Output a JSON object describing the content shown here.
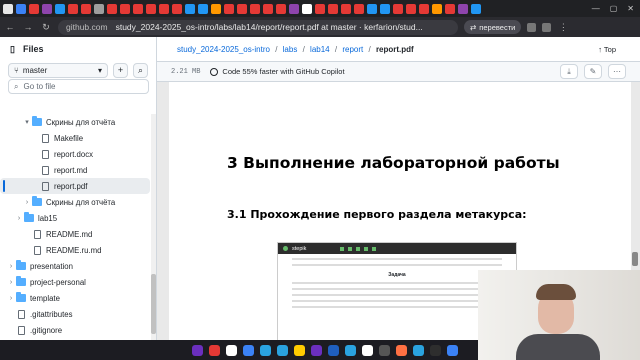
{
  "browser": {
    "url_host": "github.com",
    "url_title": "study_2024-2025_os-intro/labs/lab14/report/report.pdf at master · kerfarion/stud...",
    "translate_label": "перевести",
    "tab_colors": [
      "#e7e7e7",
      "#3b82f6",
      "#e53935",
      "#8e44ad",
      "#2196f3",
      "#e53935",
      "#e53935",
      "#9e9e9e",
      "#e53935",
      "#e53935",
      "#e53935",
      "#e53935",
      "#e53935",
      "#e53935",
      "#2196f3",
      "#2196f3",
      "#ff9800",
      "#e53935",
      "#e53935",
      "#e53935",
      "#e53935",
      "#e53935",
      "#8e44ad",
      "#ffffff",
      "#e53935",
      "#e53935",
      "#e53935",
      "#e53935",
      "#2196f3",
      "#2196f3",
      "#e53935",
      "#e53935",
      "#e53935",
      "#ff9800",
      "#e53935",
      "#8e44ad",
      "#2196f3"
    ]
  },
  "sidebar": {
    "title": "Files",
    "branch": "master",
    "search_placeholder": "Go to file",
    "tree": [
      {
        "label": "Скрины для отчёта",
        "type": "folder",
        "indent": 1,
        "expanded": true
      },
      {
        "label": "Makefile",
        "type": "file",
        "indent": 2
      },
      {
        "label": "report.docx",
        "type": "file",
        "indent": 2
      },
      {
        "label": "report.md",
        "type": "file",
        "indent": 2
      },
      {
        "label": "report.pdf",
        "type": "file",
        "indent": 2,
        "selected": true
      },
      {
        "label": "Скрины для отчёта",
        "type": "folder",
        "indent": 1,
        "expanded": false
      },
      {
        "label": "lab15",
        "type": "folder",
        "indent": 0,
        "expanded": false
      },
      {
        "label": "README.md",
        "type": "file",
        "indent": 1
      },
      {
        "label": "README.ru.md",
        "type": "file",
        "indent": 1
      },
      {
        "label": "presentation",
        "type": "folder",
        "indent": -1,
        "expanded": false
      },
      {
        "label": "project-personal",
        "type": "folder",
        "indent": -1,
        "expanded": false
      },
      {
        "label": "template",
        "type": "folder",
        "indent": -1,
        "expanded": false
      },
      {
        "label": ".gitattributes",
        "type": "file",
        "indent": -1
      },
      {
        "label": ".gitignore",
        "type": "file",
        "indent": -1
      }
    ]
  },
  "breadcrumb": {
    "repo": "study_2024-2025_os-intro",
    "parts": [
      "labs",
      "lab14",
      "report"
    ],
    "current": "report.pdf"
  },
  "top_link": "Top",
  "infobar": {
    "size": "2.21 MB",
    "copilot_text": "Code 55% faster with GitHub Copilot"
  },
  "pdf": {
    "heading1": "3  Выполнение лабораторной работы",
    "heading2": "3.1  Прохождение первого раздела метакурса:",
    "embed_brand": "stepik",
    "embed_title": "Задача"
  },
  "taskbar_colors": [
    "#6b2fbf",
    "#e53935",
    "#ffffff",
    "#3b82f6",
    "#2aa3e0",
    "#2aa3e0",
    "#ffcc00",
    "#6b2fbf",
    "#1f5fbf",
    "#2aa3e0",
    "#ffffff",
    "#555555",
    "#ff7043",
    "#2aa3e0",
    "#2e2e2e",
    "#3b82f6"
  ]
}
